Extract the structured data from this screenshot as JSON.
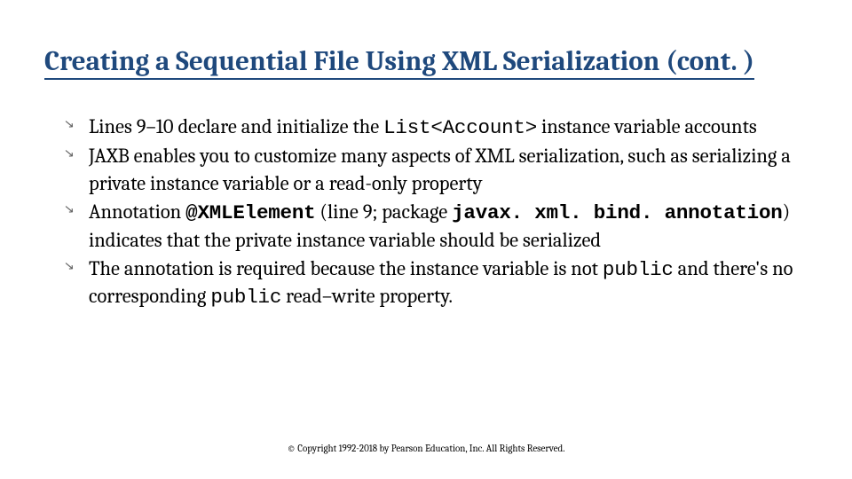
{
  "title": "Creating a Sequential File Using XML Serialization (cont. )",
  "bullets": {
    "b1": {
      "t1": "Lines 9–10 declare and initialize the ",
      "code1": "List<Account>",
      "t2": " instance variable accounts"
    },
    "b2": {
      "t1": "JAXB enables you to customize many aspects of XML serialization, such as serializing a private instance variable or a read-only property"
    },
    "b3": {
      "t1": "Annotation ",
      "code1": "@XMLElement",
      "t2": " (line 9; package ",
      "code2": "javax. xml. bind. annotation",
      "t3": ") indicates that the private instance variable should be serialized"
    },
    "b4": {
      "t1": "The annotation is required because the instance variable is not ",
      "code1": "public",
      "t2": " and there's no corresponding ",
      "code2": "public",
      "t3": " read–write property."
    }
  },
  "footer": "© Copyright 1992-2018 by Pearson Education, Inc. All Rights Reserved."
}
